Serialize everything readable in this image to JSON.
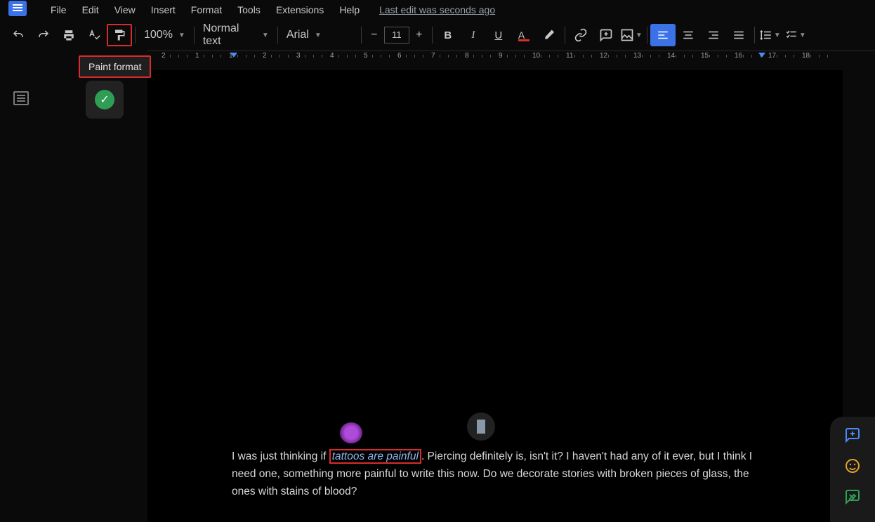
{
  "menubar": {
    "file": "File",
    "edit": "Edit",
    "view": "View",
    "insert": "Insert",
    "format": "Format",
    "tools": "Tools",
    "extensions": "Extensions",
    "help": "Help",
    "last_edit": "Last edit was seconds ago"
  },
  "toolbar": {
    "zoom": "100%",
    "style": "Normal text",
    "font": "Arial",
    "font_size": "11"
  },
  "tooltip": "Paint format",
  "ruler": {
    "labels": [
      "2",
      "1",
      "1",
      "2",
      "3",
      "4",
      "5",
      "6",
      "7",
      "8",
      "9",
      "10",
      "11",
      "12",
      "13",
      "14",
      "15",
      "16",
      "17",
      "18"
    ]
  },
  "document": {
    "text_before": "I was just thinking if ",
    "highlight": "tattoos are painful",
    "text_after": ". Piercing definitely is, isn't it? I haven't had any of it ever, but I think I need one, something more painful to write this now. Do we decorate stories with broken pieces of glass, the ones with stains of blood?"
  }
}
